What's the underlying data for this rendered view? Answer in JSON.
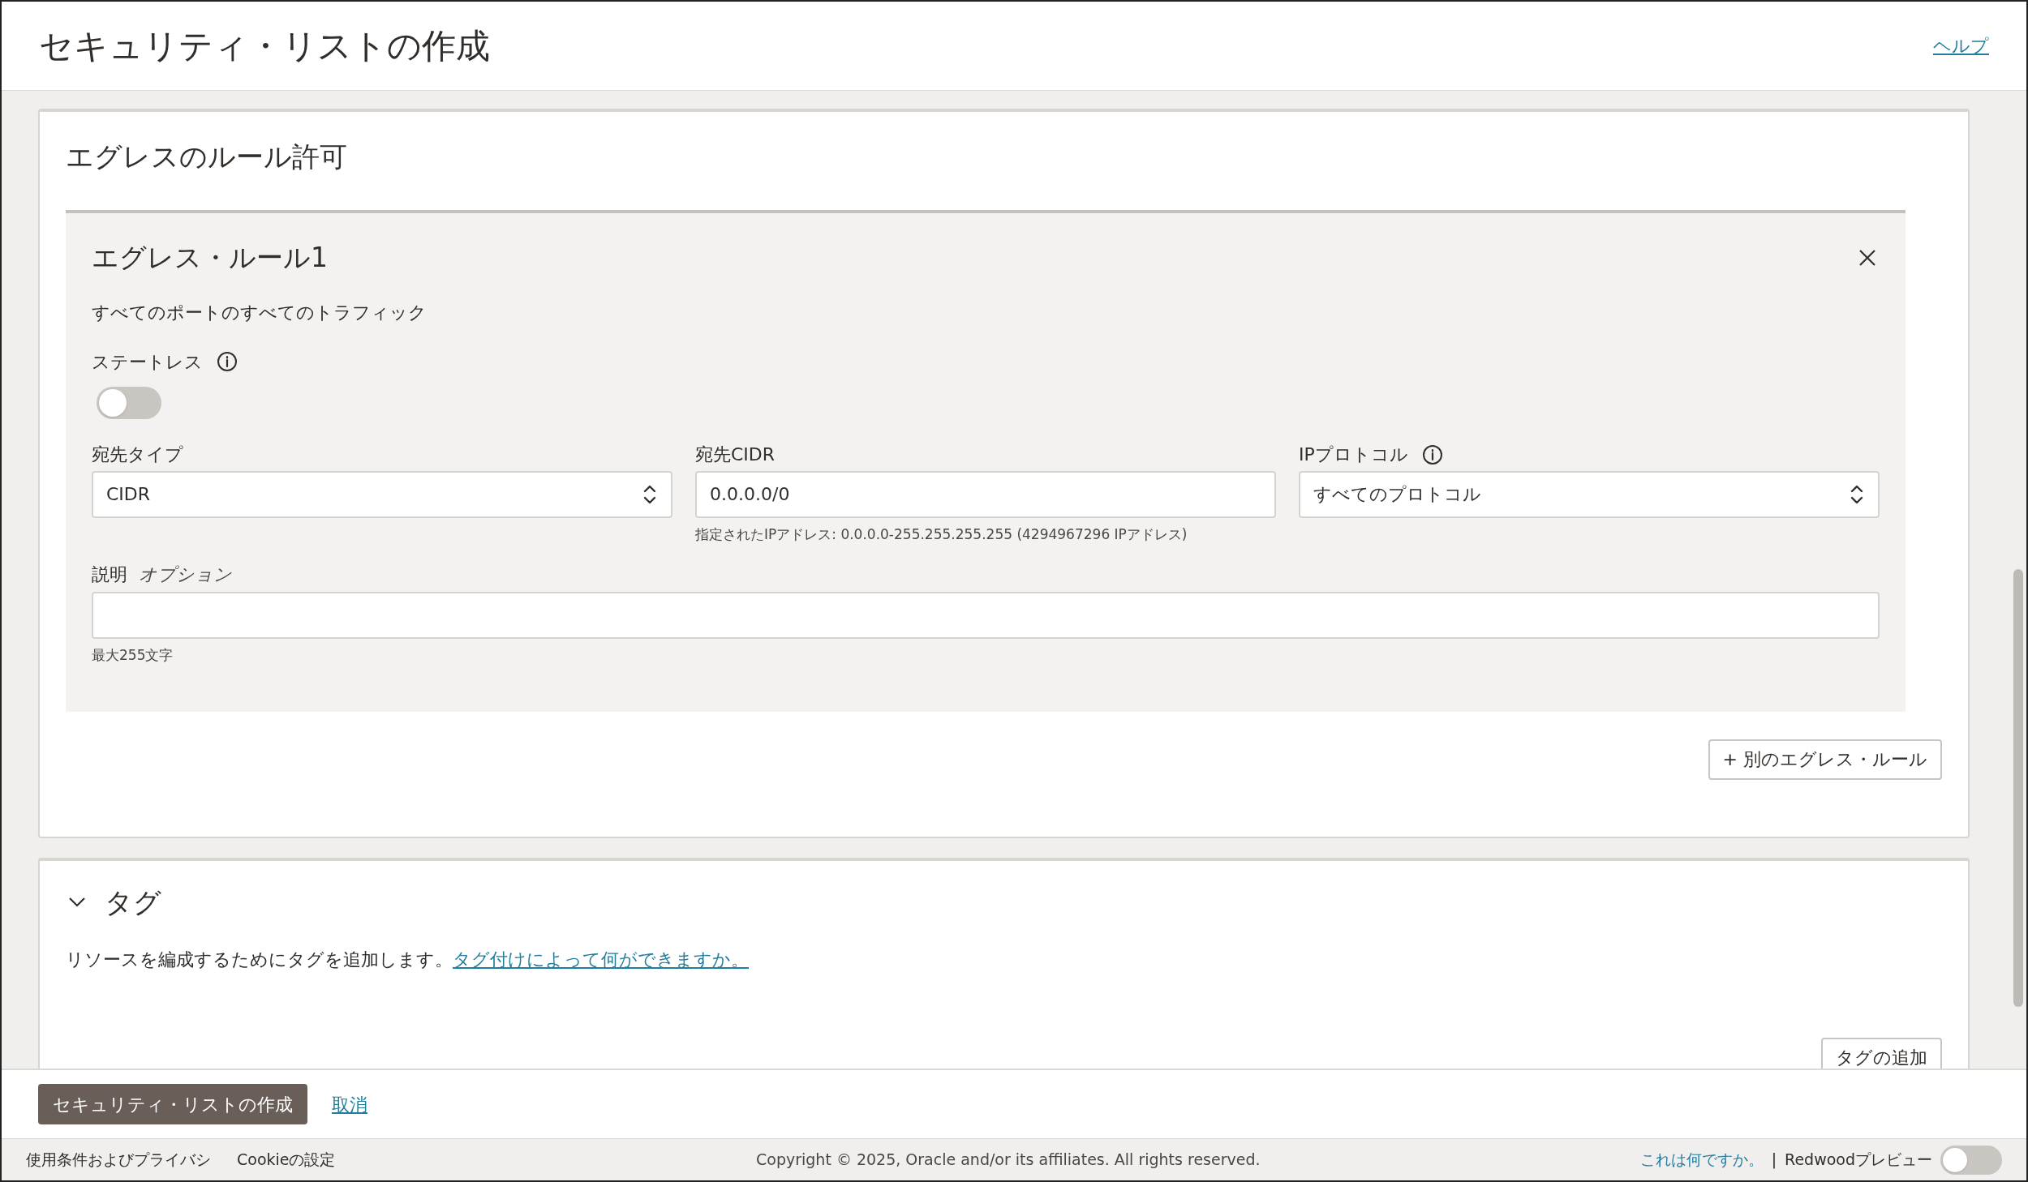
{
  "header": {
    "title": "セキュリティ・リストの作成",
    "help_link": "ヘルプ"
  },
  "egress_section": {
    "title": "エグレスのルール許可",
    "rules": [
      {
        "title": "エグレス・ルール1",
        "summary": "すべてのポートのすべてのトラフィック",
        "stateless": {
          "label": "ステートレス",
          "on": false
        },
        "fields": [
          {
            "kind": "select",
            "label": "宛先タイプ",
            "info": false,
            "value": "CIDR"
          },
          {
            "kind": "text",
            "label": "宛先CIDR",
            "info": false,
            "value": "0.0.0.0/0",
            "hint": "指定されたIPアドレス: 0.0.0.0-255.255.255.255 (4294967296 IPアドレス)"
          },
          {
            "kind": "select",
            "label": "IPプロトコル",
            "info": true,
            "value": "すべてのプロトコル"
          }
        ],
        "description": {
          "label": "説明",
          "optional": "オプション",
          "hint": "最大255文字"
        }
      }
    ],
    "add_button": "+ 別のエグレス・ルール"
  },
  "tags_section": {
    "title": "タグ",
    "expanded": true,
    "text": "リソースを編成するためにタグを追加します。",
    "link": "タグ付けによって何ができますか。",
    "add_button": "タグの追加"
  },
  "actions": {
    "primary": "セキュリティ・リストの作成",
    "cancel": "取消"
  },
  "footer": {
    "links": [
      "使用条件およびプライバシ",
      "Cookieの設定"
    ],
    "copyright": "Copyright © 2025, Oracle and/or its affiliates. All rights reserved.",
    "whats_this": "これは何ですか。",
    "separator": "|",
    "preview": {
      "label": "Redwoodプレビュー",
      "on": false
    }
  }
}
